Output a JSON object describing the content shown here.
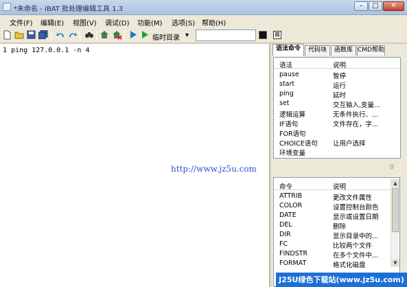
{
  "window": {
    "title": "*未命名 - iBAT 批处理编辑工具 1.3",
    "minimize_glyph": "–",
    "maximize_glyph": "□",
    "close_glyph": "✕"
  },
  "menu": [
    {
      "label": "文件(F)"
    },
    {
      "label": "编辑(E)"
    },
    {
      "label": "视图(V)"
    },
    {
      "label": "调试(D)"
    },
    {
      "label": "功能(M)"
    },
    {
      "label": "选项(S)"
    },
    {
      "label": "帮助(H)"
    }
  ],
  "toolbar": {
    "temp_dir_label": "临时目录",
    "dropdown_glyph": "▾",
    "input_value": ""
  },
  "editor": {
    "line_number": "1",
    "code": "ping 127.0.0.1 -n 4",
    "watermark": "http://www.jz5u.com"
  },
  "tabs": [
    {
      "label": "语法命令",
      "active": true
    },
    {
      "label": "代码块",
      "active": false
    },
    {
      "label": "函数库",
      "active": false
    },
    {
      "label": "CMD帮助",
      "active": false
    }
  ],
  "syntax_list": {
    "col1": "语法",
    "col2": "说明",
    "rows": [
      {
        "name": "pause",
        "desc": "暂停"
      },
      {
        "name": "start",
        "desc": "运行"
      },
      {
        "name": "ping",
        "desc": "延时"
      },
      {
        "name": "set",
        "desc": "交互输入,变量..."
      },
      {
        "name": "逻辑运算",
        "desc": "无条件执行、..."
      },
      {
        "name": "IF语句",
        "desc": "文件存在，字..."
      },
      {
        "name": "FOR语句",
        "desc": ""
      },
      {
        "name": "CHOICE语句",
        "desc": "让用户选择"
      },
      {
        "name": "环境变量",
        "desc": ""
      }
    ]
  },
  "counter_text": "0",
  "command_list": {
    "col1": "命令",
    "col2": "说明",
    "rows": [
      {
        "name": "ATTRIB",
        "desc": "更改文件属性"
      },
      {
        "name": "COLOR",
        "desc": "设置控制台颜色"
      },
      {
        "name": "DATE",
        "desc": "显示或设置日期"
      },
      {
        "name": "DEL",
        "desc": "删除"
      },
      {
        "name": "DIR",
        "desc": "显示目录中的..."
      },
      {
        "name": "FC",
        "desc": "比较两个文件"
      },
      {
        "name": "FINDSTR",
        "desc": "在多个文件中..."
      },
      {
        "name": "FORMAT",
        "desc": "格式化磁盘"
      }
    ]
  },
  "banner": "J25U绿色下载站(www.jz5u.com)"
}
